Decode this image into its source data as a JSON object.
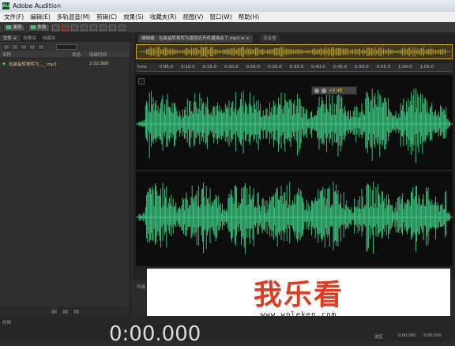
{
  "window": {
    "title": "Adobe Audition",
    "icon": "audition-app-icon"
  },
  "menu": [
    "文件(F)",
    "编辑(E)",
    "多轨混音(M)",
    "剪辑(C)",
    "效果(S)",
    "收藏夹(R)",
    "视图(V)",
    "窗口(W)",
    "帮助(H)"
  ],
  "toolbar": {
    "waveform_label": "波形",
    "multitrack_label": "多轨"
  },
  "files_panel": {
    "tabs": [
      "文件 ×",
      "效果夹",
      "收藏夹"
    ],
    "columns": {
      "name": "名称",
      "status": "状态",
      "duration": "持续时间"
    },
    "rows": [
      {
        "name": "包装盒转换转为..._.mp3",
        "duration": "2:02.880"
      }
    ]
  },
  "editor": {
    "tab_label": "编辑器：包装盒转换转为遭感应开机播描话了.mp3 ≡ ×",
    "tab2_label": "混音器",
    "hud_value": "+0 dB",
    "ruler_ticks": [
      "hms",
      "0:05.0",
      "0:10.0",
      "0:15.0",
      "0:20.0",
      "0:25.0",
      "0:30.0",
      "0:35.0",
      "0:40.0",
      "0:45.0",
      "0:50.0",
      "0:55.0",
      "1:00.0",
      "1:05.0"
    ],
    "bottom_label": "传输",
    "waveform_color": "#3ecf86",
    "overview_color": "#d0a42d"
  },
  "watermark": {
    "logo": "我乐看",
    "url": "www.woleken.com"
  },
  "transport": {
    "panel_label": "时间",
    "time_display": "0:00.000",
    "selection_label": "选区",
    "start": "0:00.000",
    "end": "0:00.000"
  }
}
